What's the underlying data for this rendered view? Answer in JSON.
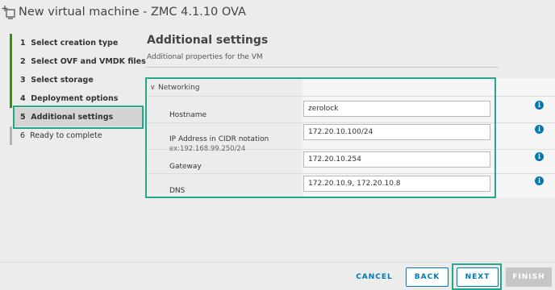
{
  "window": {
    "title": "New virtual machine - ZMC 4.1.10 OVA",
    "icon": "new-vm-icon"
  },
  "steps": [
    {
      "number": "1",
      "label": "Select creation type",
      "state": "done"
    },
    {
      "number": "2",
      "label": "Select OVF and VMDK files",
      "state": "done"
    },
    {
      "number": "3",
      "label": "Select storage",
      "state": "done"
    },
    {
      "number": "4",
      "label": "Deployment options",
      "state": "done"
    },
    {
      "number": "5",
      "label": "Additional settings",
      "state": "active"
    },
    {
      "number": "6",
      "label": "Ready to complete",
      "state": "pending"
    }
  ],
  "page": {
    "title": "Additional settings",
    "subtitle": "Additional properties for the VM"
  },
  "networking": {
    "group_label": "Networking",
    "fields": [
      {
        "label": "Hostname",
        "value": "zerolock"
      },
      {
        "label": "IP Address in CIDR notation",
        "hint": "ex:192.168.99.250/24",
        "value": "172.20.10.100/24"
      },
      {
        "label": "Gateway",
        "value": "172.20.10.254"
      },
      {
        "label": "DNS",
        "value": "172.20.10.9, 172.20.10.8"
      }
    ]
  },
  "footer": {
    "cancel": "CANCEL",
    "back": "BACK",
    "next": "NEXT",
    "finish": "FINISH"
  },
  "colors": {
    "highlight": "#25a88a",
    "accent": "#0079b8",
    "step_done_bar": "#3f8a1b",
    "step_pending_bar": "#b3b3b3"
  }
}
